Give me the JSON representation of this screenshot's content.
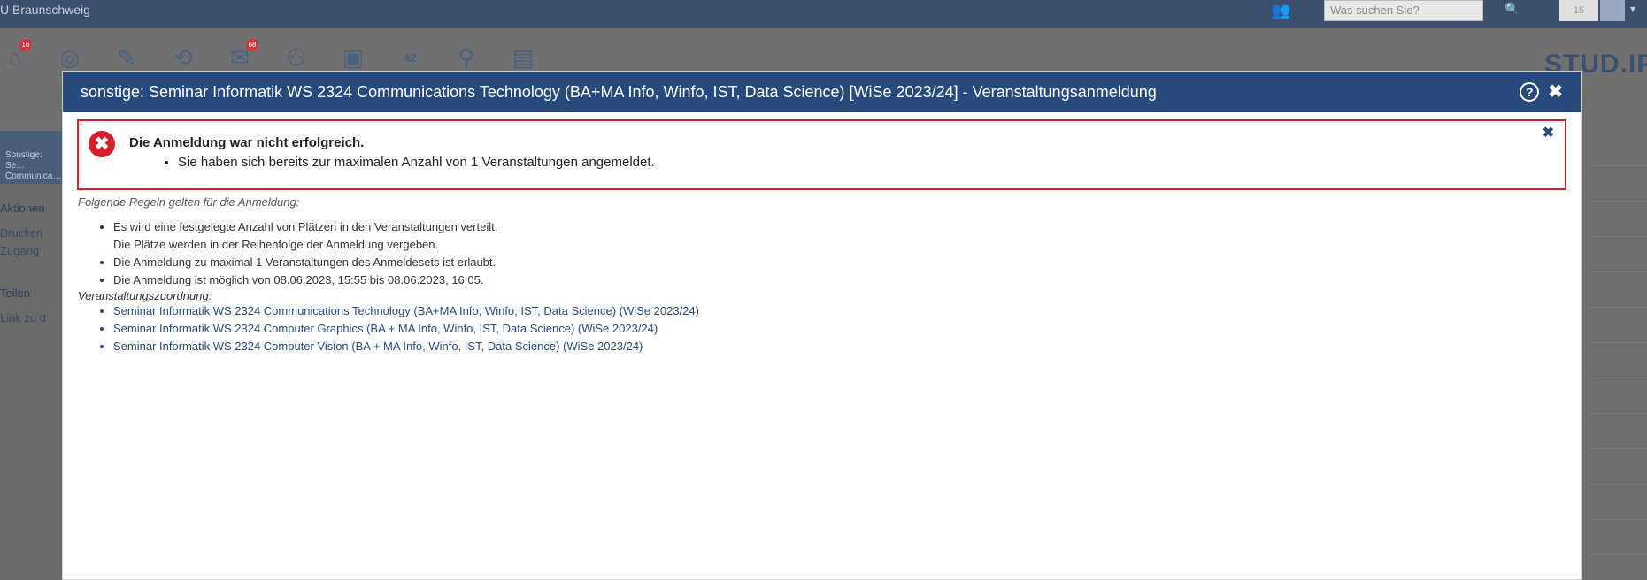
{
  "topbar": {
    "brand": "U Braunschweig",
    "search_placeholder": "Was suchen Sie?",
    "counter": "15",
    "search_icon": "search-icon",
    "people_icon": "people-icon"
  },
  "navbar": {
    "home_badge": "16",
    "mail_badge": "68",
    "calendar_day": "42",
    "logo": "STUD.IP"
  },
  "sidebar": {
    "course": "Sonstige: Se… Communica…",
    "actions_title": "Aktionen",
    "print": "Drucken",
    "access": "Zugang",
    "share_title": "Teilen",
    "link": "Link zu d"
  },
  "dialog": {
    "title": "sonstige: Seminar Informatik WS 2324 Communications Technology (BA+MA Info, Winfo, IST, Data Science) [WiSe 2023/24] - Veranstaltungsanmeldung",
    "help_label": "?",
    "close_label": "✖"
  },
  "error": {
    "title": "Die Anmeldung war nicht erfolgreich.",
    "message": "Sie haben sich bereits zur maximalen Anzahl von 1 Veranstaltungen angemeldet.",
    "close_label": "✖"
  },
  "rules": {
    "heading": "Folgende Regeln gelten für die Anmeldung:",
    "item1_line1": "Es wird eine festgelegte Anzahl von Plätzen in den Veranstaltungen verteilt.",
    "item1_line2": "Die Plätze werden in der Reihenfolge der Anmeldung vergeben.",
    "item2": "Die Anmeldung zu maximal 1 Veranstaltungen des Anmeldesets ist erlaubt.",
    "item3": "Die Anmeldung ist möglich von 08.06.2023, 15:55 bis 08.06.2023, 16:05."
  },
  "assignment": {
    "heading": "Veranstaltungszuordnung:",
    "courses": [
      "Seminar Informatik WS 2324 Communications Technology (BA+MA Info, Winfo, IST, Data Science) (WiSe 2023/24)",
      "Seminar Informatik WS 2324 Computer Graphics (BA + MA Info, Winfo, IST, Data Science) (WiSe 2023/24)",
      "Seminar Informatik WS 2324 Computer Vision (BA + MA Info, Winfo, IST, Data Science) (WiSe 2023/24)"
    ]
  },
  "colors": {
    "header": "#28497c",
    "error": "#d3202b",
    "link": "#28497c"
  }
}
